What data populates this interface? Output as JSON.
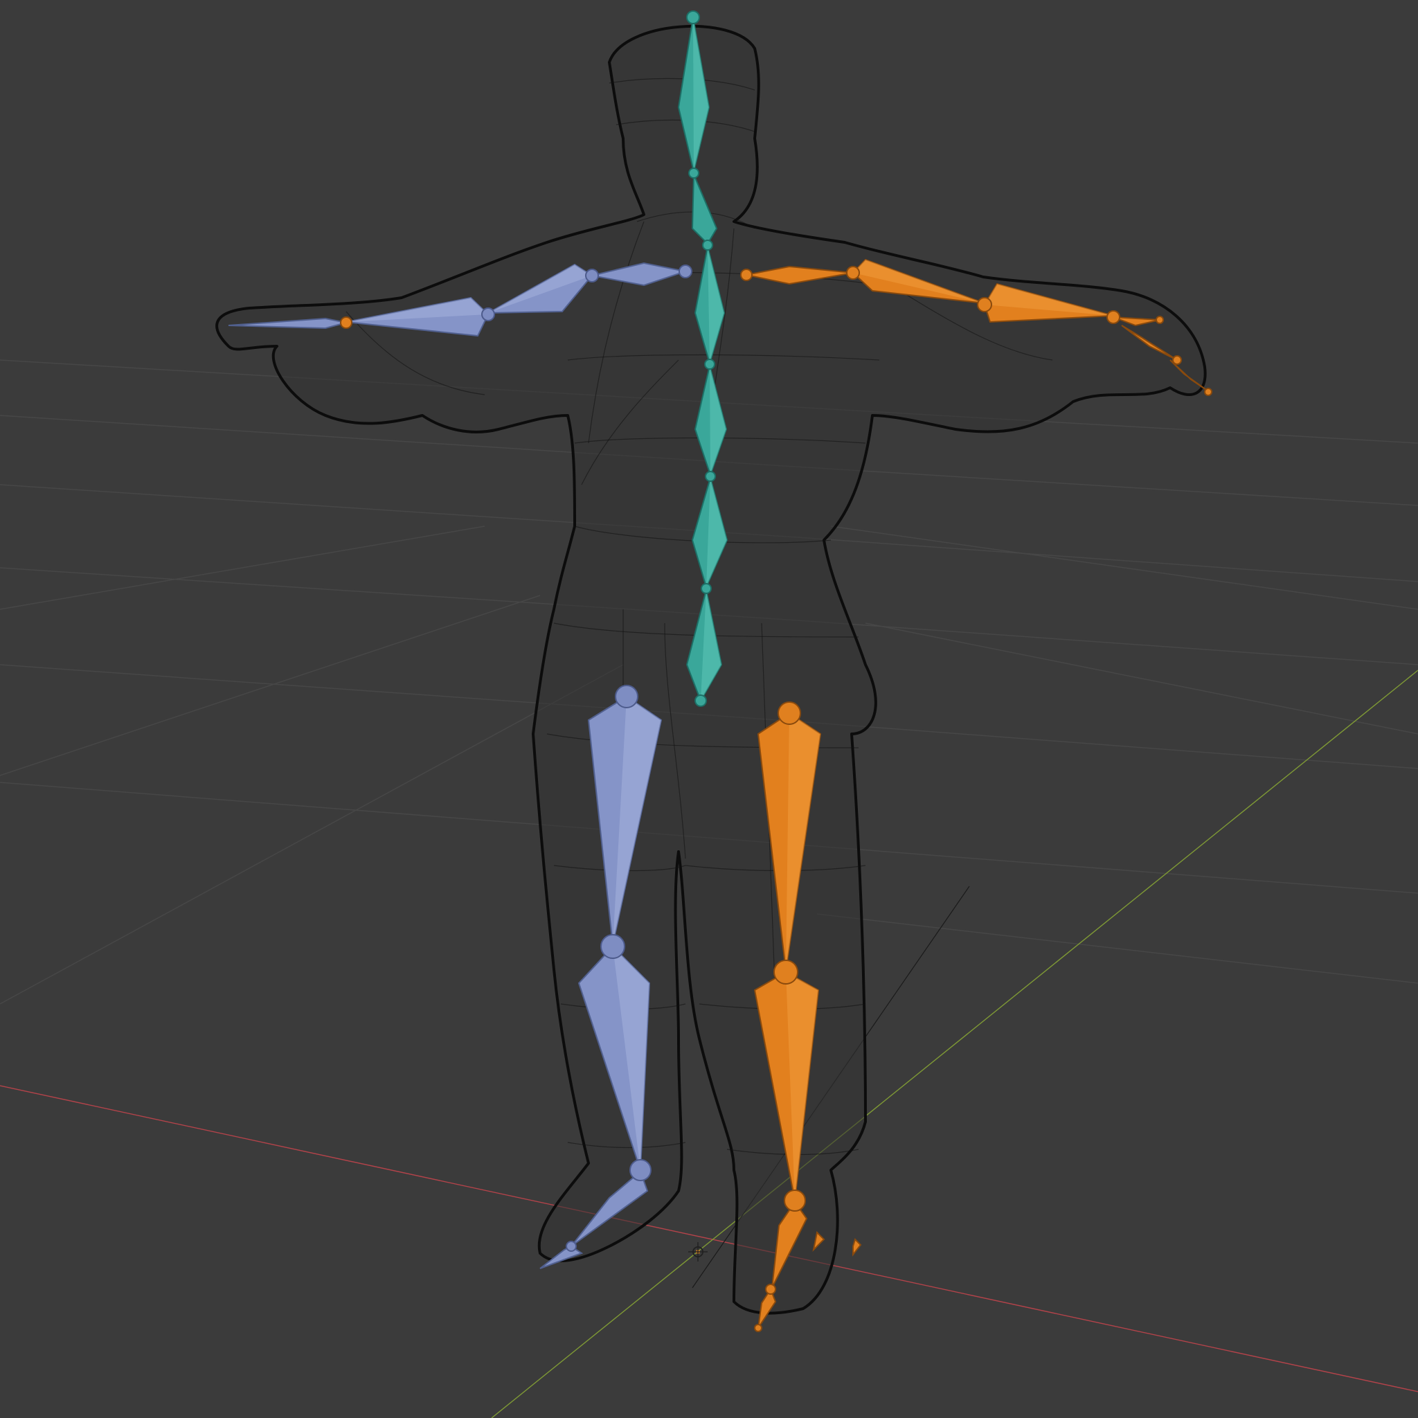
{
  "viewport": {
    "background": "#3b3b3b",
    "grid_color": "#474747",
    "x_axis_color": "#b4434a",
    "y_axis_color": "#7f9a35"
  },
  "armature": {
    "left_side_color": "#8594c8",
    "right_side_color": "#e2801e",
    "spine_color": "#3aa79a"
  },
  "mesh": {
    "display": "wireframe",
    "wire_color": "#111111"
  },
  "icons": {
    "origin_marker": "3d-cursor-icon"
  }
}
